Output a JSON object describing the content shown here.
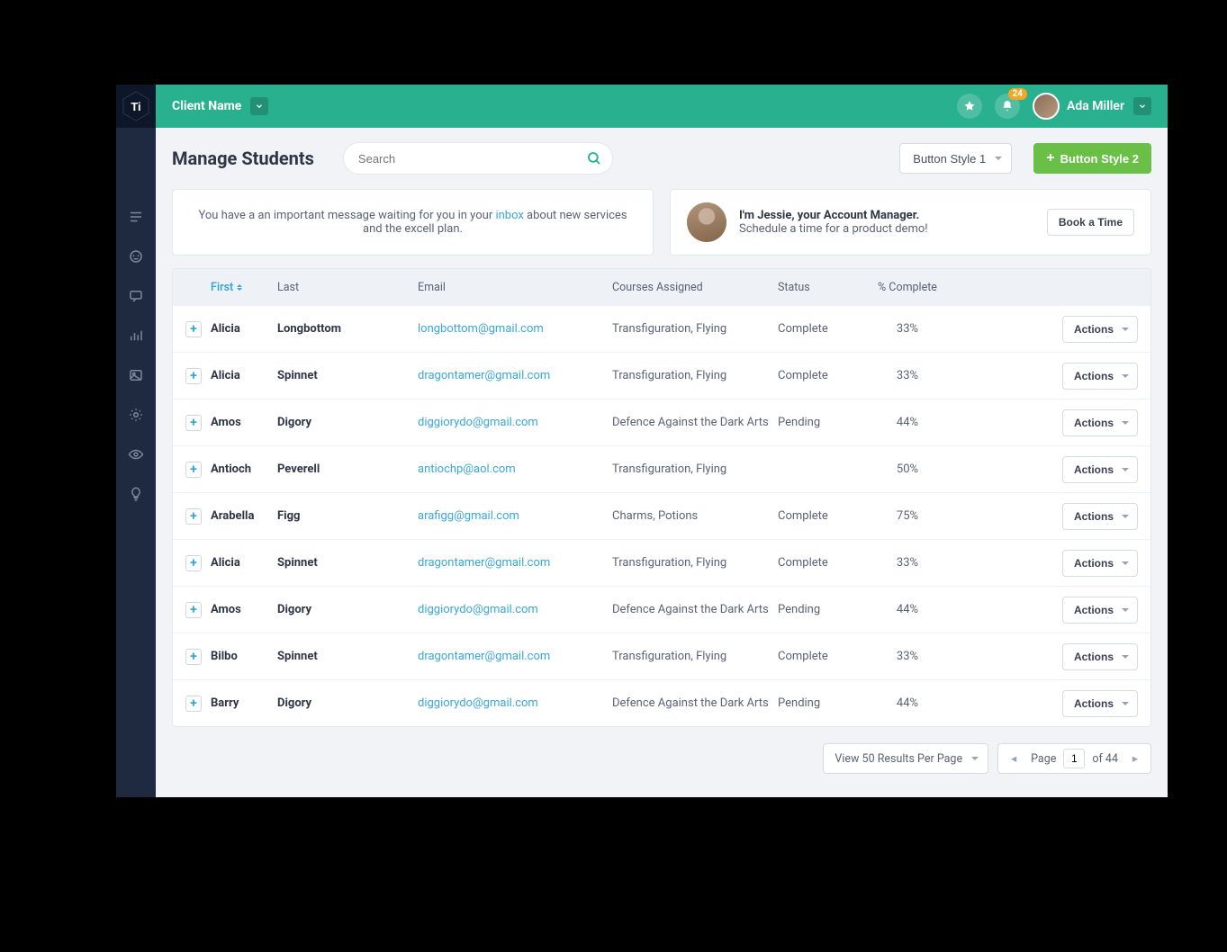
{
  "header": {
    "logo_text": "Ti",
    "client_label": "Client Name",
    "notif_count": "24",
    "user_name": "Ada Miller"
  },
  "toolbar": {
    "page_title": "Manage Students",
    "search_placeholder": "Search",
    "button_style_1": "Button Style 1",
    "button_style_2": "Button Style 2"
  },
  "banner": {
    "pre": "You have a an important message waiting for you in your ",
    "link": "inbox",
    "post": " about new services and the excell plan."
  },
  "manager": {
    "title": "I'm Jessie, your Account Manager.",
    "sub": "Schedule a time for a product demo!",
    "cta": "Book a Time"
  },
  "columns": {
    "first": "First",
    "last": "Last",
    "email": "Email",
    "courses": "Courses Assigned",
    "status": "Status",
    "complete": "% Complete"
  },
  "action_label": "Actions",
  "rows": [
    {
      "first": "Alicia",
      "last": "Longbottom",
      "email": "longbottom@gmail.com",
      "courses": "Transfiguration, Flying",
      "status": "Complete",
      "pct": "33%"
    },
    {
      "first": "Alicia",
      "last": "Spinnet",
      "email": "dragontamer@gmail.com",
      "courses": "Transfiguration, Flying",
      "status": "Complete",
      "pct": "33%"
    },
    {
      "first": "Amos",
      "last": "Digory",
      "email": "diggiorydo@gmail.com",
      "courses": "Defence Against the Dark Arts",
      "status": "Pending",
      "pct": "44%"
    },
    {
      "first": "Antioch",
      "last": "Peverell",
      "email": "antiochp@aol.com",
      "courses": "Transfiguration, Flying",
      "status": "",
      "pct": "50%"
    },
    {
      "first": "Arabella",
      "last": "Figg",
      "email": "arafigg@gmail.com",
      "courses": "Charms, Potions",
      "status": "Complete",
      "pct": "75%"
    },
    {
      "first": "Alicia",
      "last": "Spinnet",
      "email": "dragontamer@gmail.com",
      "courses": "Transfiguration, Flying",
      "status": "Complete",
      "pct": "33%"
    },
    {
      "first": "Amos",
      "last": "Digory",
      "email": "diggiorydo@gmail.com",
      "courses": "Defence Against the Dark Arts",
      "status": "Pending",
      "pct": "44%"
    },
    {
      "first": "Bilbo",
      "last": "Spinnet",
      "email": "dragontamer@gmail.com",
      "courses": "Transfiguration, Flying",
      "status": "Complete",
      "pct": "33%"
    },
    {
      "first": "Barry",
      "last": "Digory",
      "email": "diggiorydo@gmail.com",
      "courses": "Defence Against the Dark Arts",
      "status": "Pending",
      "pct": "44%"
    }
  ],
  "pager": {
    "per_page": "View 50 Results Per Page",
    "page_label": "Page",
    "current": "1",
    "total": "of 44"
  }
}
